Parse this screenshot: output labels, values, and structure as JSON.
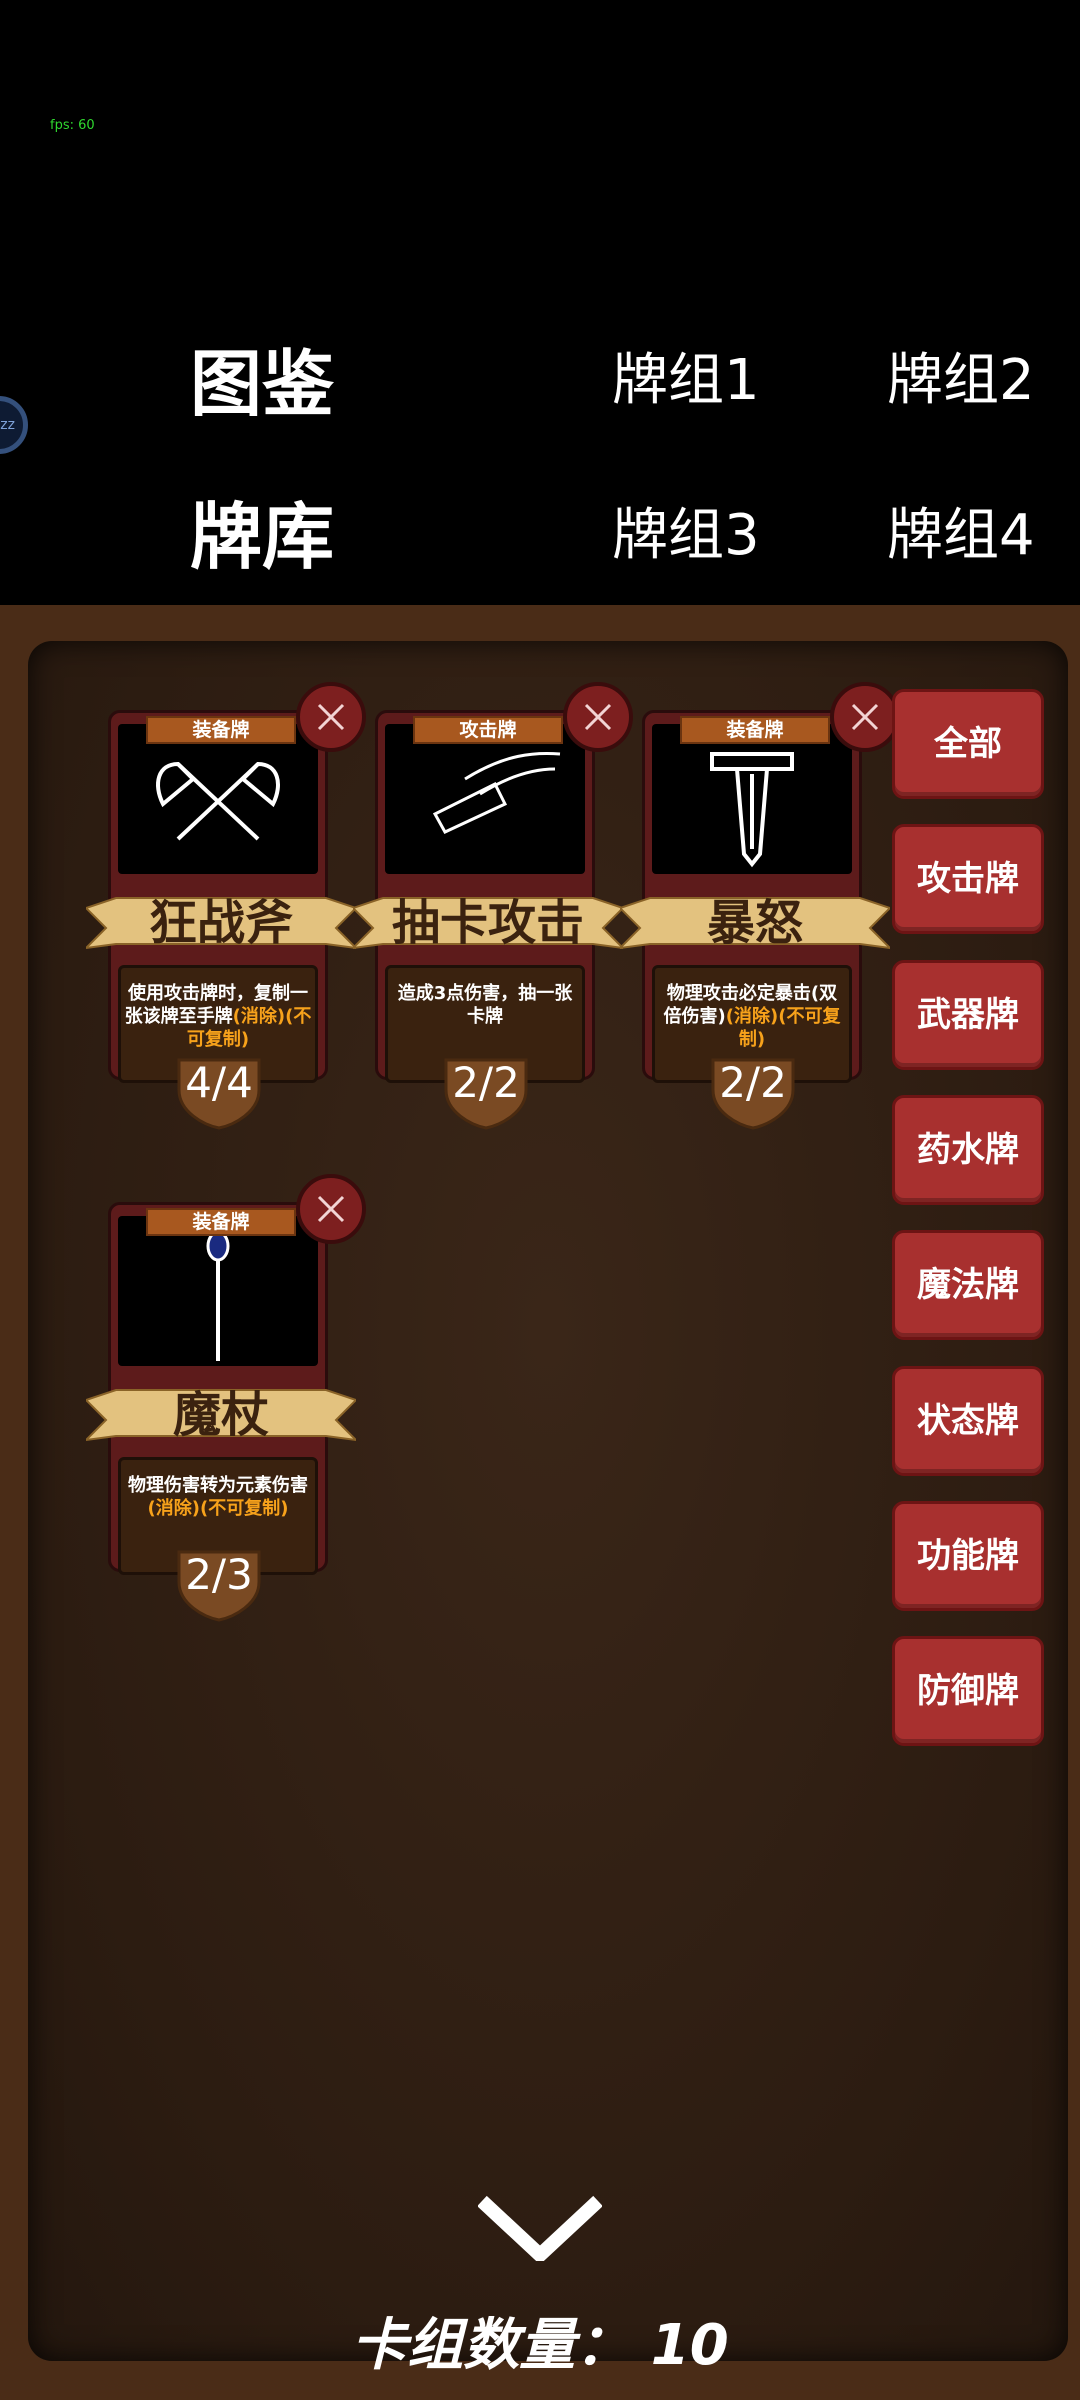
{
  "fps": "fps: 60",
  "badge": "zz",
  "nav": {
    "tujian": "图鉴",
    "paiku": "牌库",
    "deck1": "牌组1",
    "deck2": "牌组2",
    "deck3": "牌组3",
    "deck4": "牌组4"
  },
  "cards": [
    {
      "type": "装备牌",
      "name": "狂战斧",
      "desc": "使用攻击牌时，复制一张该牌至手牌",
      "desc_hl": "(消除)(不可复制)",
      "count": "4/4",
      "icon": "double-axe-icon"
    },
    {
      "type": "攻击牌",
      "name": "抽卡攻击",
      "desc": "造成3点伤害，抽一张卡牌",
      "desc_hl": "",
      "count": "2/2",
      "icon": "slash-icon"
    },
    {
      "type": "装备牌",
      "name": "暴怒",
      "desc": "物理攻击必定暴击(双倍伤害)",
      "desc_hl": "(消除)(不可复制)",
      "count": "2/2",
      "icon": "sword-icon"
    },
    {
      "type": "装备牌",
      "name": "魔杖",
      "desc": "物理伤害转为元素伤害",
      "desc_hl": "(消除)(不可复制)",
      "count": "2/3",
      "icon": "staff-icon"
    }
  ],
  "filters": [
    "全部",
    "攻击牌",
    "武器牌",
    "药水牌",
    "魔法牌",
    "状态牌",
    "功能牌",
    "防御牌"
  ],
  "deck_count": "卡组数量：  10",
  "colors": {
    "accent": "#a8302f",
    "highlight": "#f7a21b",
    "panel": "#2c1c11"
  }
}
